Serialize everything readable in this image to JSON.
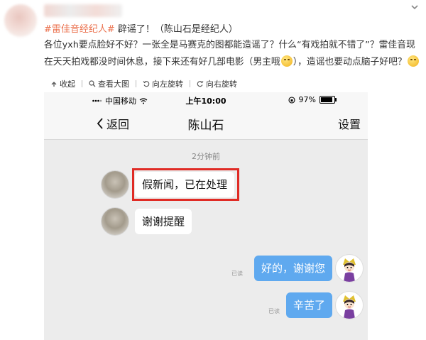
{
  "post": {
    "hashtag": "#雷佳音经纪人#",
    "headline": " 辟谣了！（陈山石是经纪人）",
    "body_part1": "各位yxh要点脸好不好？一张全是马赛克的图都能造谣了？什么“有戏拍就不错了”？雷佳音现在天天拍戏都没时间休息，接下来还有好几部电影（男主哦",
    "body_part2": "），造谣也要动点脑子好吧？"
  },
  "toolbar": {
    "collapse": "收起",
    "view_large": "查看大图",
    "rotate_left": "向左旋转",
    "rotate_right": "向右旋转"
  },
  "phone": {
    "carrier": "中国移动",
    "time": "上午10:00",
    "battery": "97%",
    "back_label": "返回",
    "chat_title": "陈山石",
    "settings_label": "设置",
    "timestamp": "2分钟前",
    "messages": [
      {
        "side": "left",
        "text": "假新闻，已在处理"
      },
      {
        "side": "left",
        "text": "谢谢提醒"
      },
      {
        "side": "right",
        "text": "好的，谢谢您",
        "status": "已读"
      },
      {
        "side": "right",
        "text": "辛苦了",
        "status": "已读"
      }
    ]
  },
  "colors": {
    "hashtag": "#eb7350",
    "bubble_right": "#5fa9ef",
    "highlight": "#e02b25"
  }
}
